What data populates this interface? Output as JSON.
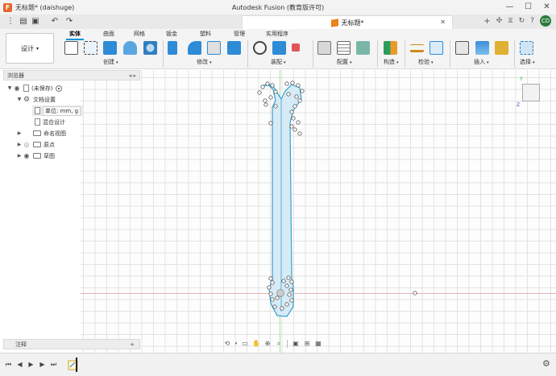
{
  "window": {
    "title": "无标题* (daishuge)",
    "app_title": "Autodesk Fusion (教育版许可)",
    "minimize": "—",
    "maximize": "☐",
    "close": "✕"
  },
  "document_tab": {
    "title": "无标题*",
    "close": "✕"
  },
  "user_initials": "CD",
  "workspace": {
    "label": "设计",
    "caret": "▾"
  },
  "ribbon_tabs": [
    "实体",
    "曲面",
    "网格",
    "钣金",
    "塑料",
    "管理",
    "实用程序"
  ],
  "ribbon_groups": [
    {
      "label": "创建"
    },
    {
      "label": "修改"
    },
    {
      "label": "装配"
    },
    {
      "label": "配置"
    },
    {
      "label": "构造"
    },
    {
      "label": "检验"
    },
    {
      "label": "插入"
    },
    {
      "label": "选择"
    }
  ],
  "browser": {
    "title": "浏览器",
    "items": [
      {
        "label": "(未保存)"
      },
      {
        "label": "文档设置"
      },
      {
        "label": "单位: mm, g"
      },
      {
        "label": "混合设计"
      },
      {
        "label": "命名视图"
      },
      {
        "label": "原点"
      },
      {
        "label": "草图"
      }
    ]
  },
  "notes": {
    "label": "注释",
    "add": "+"
  },
  "viewcube": {
    "y_label": "Y",
    "z_label": "Z"
  },
  "colors": {
    "accent": "#0696d7",
    "sketch_fill": "#d6ebf5",
    "sketch_stroke": "#3aa0d0",
    "x_axis": "#e8b3b3",
    "y_axis": "#a6dca6"
  }
}
